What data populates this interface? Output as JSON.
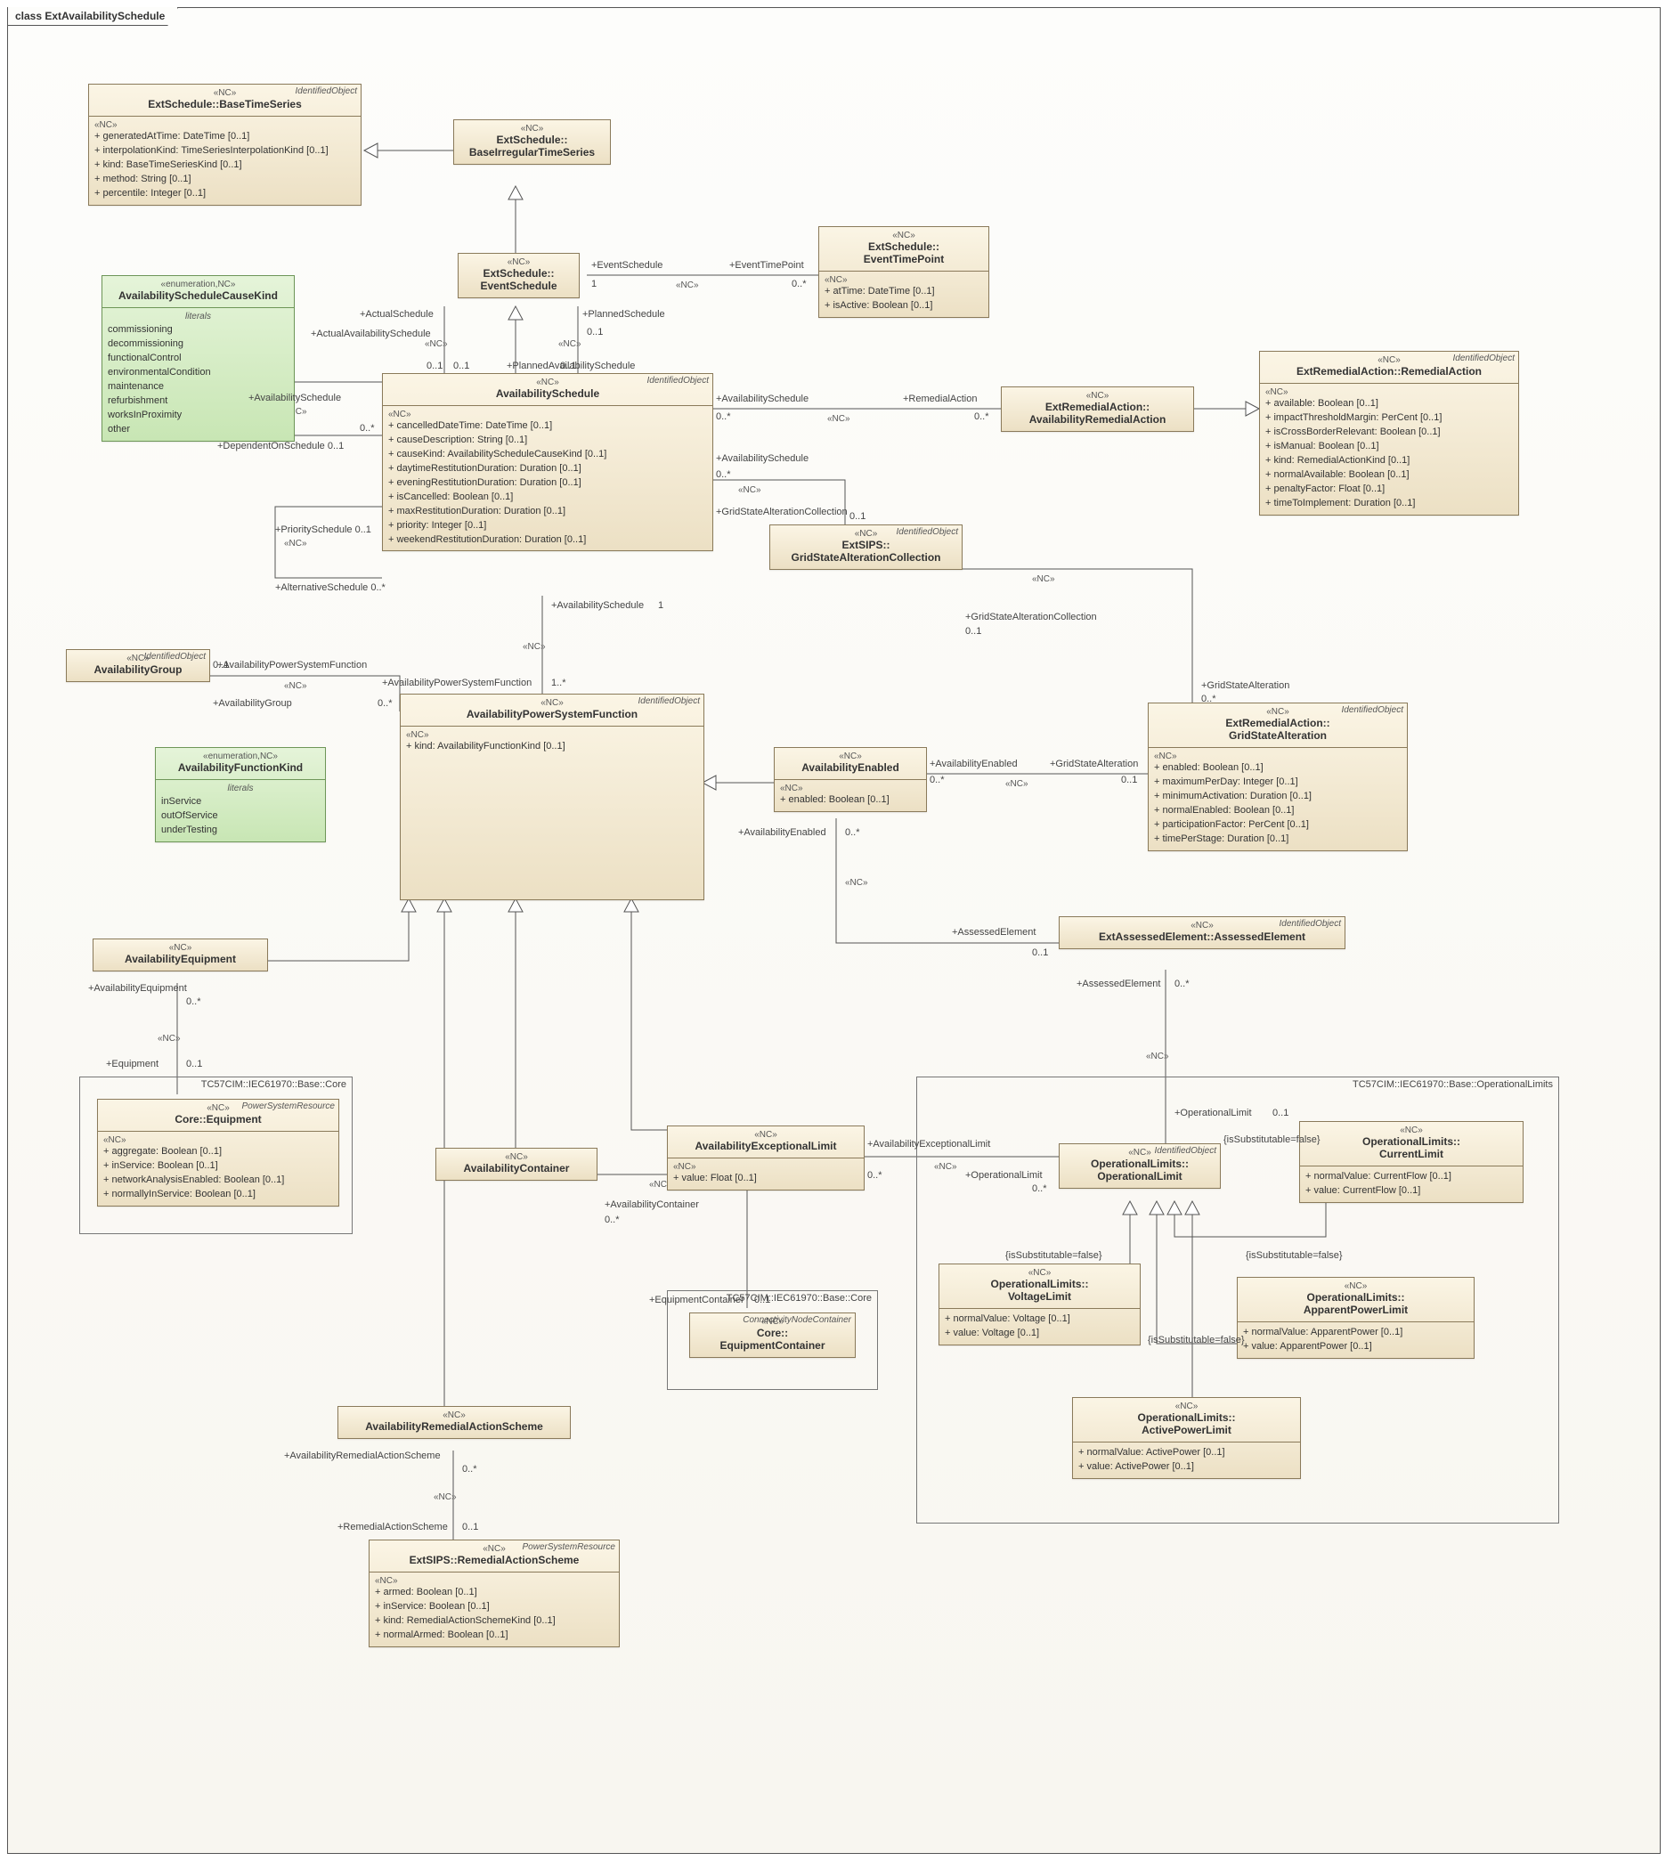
{
  "title": "class ExtAvailabilitySchedule",
  "classes": {
    "BaseTimeSeries": {
      "corner": "IdentifiedObject",
      "stereo": "«NC»",
      "name": "ExtSchedule::BaseTimeSeries",
      "sectionStereo": "«NC»",
      "attrs": [
        "+   generatedAtTime: DateTime [0..1]",
        "+   interpolationKind: TimeSeriesInterpolationKind [0..1]",
        "+   kind: BaseTimeSeriesKind [0..1]",
        "+   method: String [0..1]",
        "+   percentile: Integer [0..1]"
      ]
    },
    "BaseIrregularTimeSeries": {
      "stereo": "«NC»",
      "name": "ExtSchedule::\nBaseIrregularTimeSeries"
    },
    "EventSchedule": {
      "stereo": "«NC»",
      "name": "ExtSchedule::\nEventSchedule"
    },
    "EventTimePoint": {
      "stereo": "«NC»",
      "name": "ExtSchedule::\nEventTimePoint",
      "sectionStereo": "«NC»",
      "attrs": [
        "+   atTime: DateTime [0..1]",
        "+   isActive: Boolean [0..1]"
      ]
    },
    "AvailabilityScheduleCauseKind": {
      "stereo": "«enumeration,NC»",
      "name": "AvailabilityScheduleCauseKind",
      "sectionLabel": "literals",
      "literals": [
        "commissioning",
        "decommissioning",
        "functionalControl",
        "environmentalCondition",
        "maintenance",
        "refurbishment",
        "worksInProximity",
        "other"
      ]
    },
    "AvailabilitySchedule": {
      "corner": "IdentifiedObject",
      "stereo": "«NC»",
      "name": "AvailabilitySchedule",
      "sectionStereo": "«NC»",
      "attrs": [
        "+   cancelledDateTime: DateTime [0..1]",
        "+   causeDescription: String [0..1]",
        "+   causeKind: AvailabilityScheduleCauseKind [0..1]",
        "+   daytimeRestitutionDuration: Duration [0..1]",
        "+   eveningRestitutionDuration: Duration [0..1]",
        "+   isCancelled: Boolean [0..1]",
        "+   maxRestitutionDuration: Duration [0..1]",
        "+   priority: Integer [0..1]",
        "+   weekendRestitutionDuration: Duration [0..1]"
      ]
    },
    "AvailabilityRemedialAction": {
      "stereo": "«NC»",
      "name": "ExtRemedialAction::\nAvailabilityRemedialAction"
    },
    "RemedialAction": {
      "corner": "IdentifiedObject",
      "stereo": "«NC»",
      "name": "ExtRemedialAction::RemedialAction",
      "sectionStereo": "«NC»",
      "attrs": [
        "+   available: Boolean [0..1]",
        "+   impactThresholdMargin: PerCent [0..1]",
        "+   isCrossBorderRelevant: Boolean [0..1]",
        "+   isManual: Boolean [0..1]",
        "+   kind: RemedialActionKind [0..1]",
        "+   normalAvailable: Boolean [0..1]",
        "+   penaltyFactor: Float [0..1]",
        "+   timeToImplement: Duration [0..1]"
      ]
    },
    "GridStateAlterationCollection": {
      "corner": "IdentifiedObject",
      "stereo": "«NC»",
      "name": "ExtSIPS::\nGridStateAlterationCollection"
    },
    "AvailabilityGroup": {
      "corner": "IdentifiedObject",
      "stereo": "«NC»",
      "name": "AvailabilityGroup"
    },
    "AvailabilityFunctionKind": {
      "stereo": "«enumeration,NC»",
      "name": "AvailabilityFunctionKind",
      "sectionLabel": "literals",
      "literals": [
        "inService",
        "outOfService",
        "underTesting"
      ]
    },
    "AvailabilityPowerSystemFunction": {
      "corner": "IdentifiedObject",
      "stereo": "«NC»",
      "name": "AvailabilityPowerSystemFunction",
      "sectionStereo": "«NC»",
      "attrs": [
        "+   kind: AvailabilityFunctionKind [0..1]"
      ]
    },
    "AvailabilityEnabled": {
      "stereo": "«NC»",
      "name": "AvailabilityEnabled",
      "sectionStereo": "«NC»",
      "attrs": [
        "+   enabled: Boolean [0..1]"
      ]
    },
    "GridStateAlteration": {
      "corner": "IdentifiedObject",
      "stereo": "«NC»",
      "name": "ExtRemedialAction::\nGridStateAlteration",
      "sectionStereo": "«NC»",
      "attrs": [
        "+   enabled: Boolean [0..1]",
        "+   maximumPerDay: Integer [0..1]",
        "+   minimumActivation: Duration [0..1]",
        "+   normalEnabled: Boolean [0..1]",
        "+   participationFactor: PerCent [0..1]",
        "+   timePerStage: Duration [0..1]"
      ]
    },
    "AssessedElement": {
      "corner": "IdentifiedObject",
      "stereo": "«NC»",
      "name": "ExtAssessedElement::AssessedElement"
    },
    "AvailabilityEquipment": {
      "stereo": "«NC»",
      "name": "AvailabilityEquipment"
    },
    "Equipment": {
      "corner": "PowerSystemResource",
      "stereo": "«NC»",
      "name": "Core::Equipment",
      "sectionStereo": "«NC»",
      "attrs": [
        "+   aggregate: Boolean [0..1]",
        "+   inService: Boolean [0..1]",
        "+   networkAnalysisEnabled: Boolean [0..1]",
        "+   normallyInService: Boolean [0..1]"
      ]
    },
    "AvailabilityContainer": {
      "stereo": "«NC»",
      "name": "AvailabilityContainer"
    },
    "AvailabilityExceptionalLimit": {
      "stereo": "«NC»",
      "name": "AvailabilityExceptionalLimit",
      "sectionStereo": "«NC»",
      "attrs": [
        "+   value: Float [0..1]"
      ]
    },
    "AvailabilityRemedialActionScheme": {
      "stereo": "«NC»",
      "name": "AvailabilityRemedialActionScheme"
    },
    "EquipmentContainer": {
      "corner": "ConnectivityNodeContainer",
      "stereo": "«NC»",
      "name": "Core::\nEquipmentContainer"
    },
    "RemedialActionScheme": {
      "corner": "PowerSystemResource",
      "stereo": "«NC»",
      "name": "ExtSIPS::RemedialActionScheme",
      "sectionStereo": "«NC»",
      "attrs": [
        "+   armed: Boolean [0..1]",
        "+   inService: Boolean [0..1]",
        "+   kind: RemedialActionSchemeKind [0..1]",
        "+   normalArmed: Boolean [0..1]"
      ]
    },
    "OperationalLimit": {
      "corner": "IdentifiedObject",
      "stereo": "«NC»",
      "name": "OperationalLimits::\nOperationalLimit"
    },
    "CurrentLimit": {
      "stereo": "«NC»",
      "name": "OperationalLimits::\nCurrentLimit",
      "attrs": [
        "+   normalValue: CurrentFlow [0..1]",
        "+   value: CurrentFlow [0..1]"
      ]
    },
    "VoltageLimit": {
      "stereo": "«NC»",
      "name": "OperationalLimits::\nVoltageLimit",
      "attrs": [
        "+   normalValue: Voltage [0..1]",
        "+   value: Voltage [0..1]"
      ]
    },
    "ApparentPowerLimit": {
      "stereo": "«NC»",
      "name": "OperationalLimits::\nApparentPowerLimit",
      "attrs": [
        "+   normalValue: ApparentPower [0..1]",
        "+   value: ApparentPower [0..1]"
      ]
    },
    "ActivePowerLimit": {
      "stereo": "«NC»",
      "name": "OperationalLimits::\nActivePowerLimit",
      "attrs": [
        "+   normalValue: ActivePower [0..1]",
        "+   value: ActivePower [0..1]"
      ]
    }
  },
  "parcels": {
    "coreEquipment": "TC57CIM::IEC61970::Base::Core",
    "coreEquipmentContainer": "TC57CIM::IEC61970::Base::Core",
    "operationalLimits": "TC57CIM::IEC61970::Base::OperationalLimits"
  },
  "labels": {
    "l1": "+EventSchedule",
    "l2": "+EventTimePoint",
    "l3": "1",
    "l4": "0..*",
    "l5": "+ActualSchedule",
    "l6": "0..1",
    "l7": "+PlannedSchedule",
    "l8": "0..1",
    "l9": "+ActualAvailabilitySchedule",
    "l10": "0..1",
    "l11": "+PlannedAvailabilitySchedule",
    "l12": "0..1",
    "l13": "+AvailabilitySchedule",
    "l14": "0..*",
    "l15": "+DependentOnSchedule 0..1",
    "l16": "+PrioritySchedule 0..1",
    "l17": "+AlternativeSchedule 0..*",
    "l18": "+AvailabilitySchedule",
    "l19": "0..*",
    "l20": "+RemedialAction",
    "l21": "0..*",
    "l22": "+AvailabilitySchedule",
    "l23": "0..*",
    "l24": "+GridStateAlterationCollection",
    "l25": "0..1",
    "l26": "+GridStateAlterationCollection",
    "l27": "0..1",
    "l28": "+GridStateAlteration",
    "l29": "0..*",
    "l30": "+AvailabilitySchedule",
    "l31": "1",
    "l32": "+AvailabilityPowerSystemFunction",
    "l33": "1..*",
    "l34": "+AvailabilityPowerSystemFunction",
    "l35": "0..*",
    "l36": "+AvailabilityGroup",
    "l37": "0..1",
    "l38": "+AvailabilityEnabled",
    "l39": "0..*",
    "l40": "+GridStateAlteration",
    "l41": "0..1",
    "l42": "+AvailabilityEnabled",
    "l43": "0..*",
    "l44": "+AssessedElement",
    "l45": "0..1",
    "l46": "+AssessedElement",
    "l47": "0..*",
    "l48": "+OperationalLimit",
    "l49": "0..1",
    "l50": "+AvailabilityExceptionalLimit",
    "l51": "0..*",
    "l52": "+OperationalLimit",
    "l53": "0..*",
    "l54": "+AvailabilityEquipment",
    "l55": "0..*",
    "l56": "+Equipment",
    "l57": "0..1",
    "l58": "+AvailabilityContainer",
    "l59": "0..*",
    "l60": "+EquipmentContainer",
    "l61": "0..1",
    "l62": "+AvailabilityRemedialActionScheme",
    "l63": "0..*",
    "l64": "+RemedialActionScheme",
    "l65": "0..1",
    "l66": "{isSubstitutable=false}",
    "l67": "{isSubstitutable=false}",
    "l68": "{isSubstitutable=false}",
    "l69": "{isSubstitutable=false}",
    "nc": "«NC»"
  }
}
